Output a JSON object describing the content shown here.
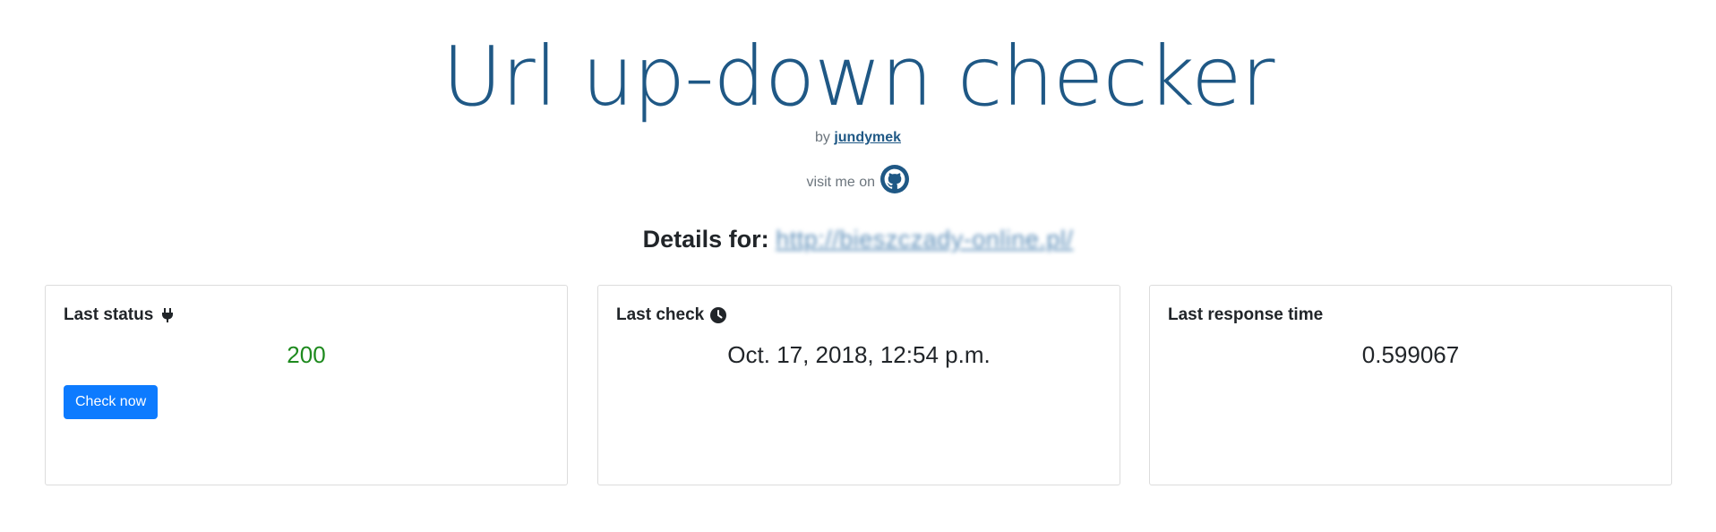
{
  "header": {
    "title": "Url up-down checker",
    "by_prefix": "by",
    "author": "jundymek",
    "visit_text": "visit me on",
    "github_icon": "github-icon"
  },
  "details": {
    "label": "Details for:",
    "url": "http://bieszczady-online.pl/"
  },
  "cards": {
    "status": {
      "title": "Last status",
      "icon": "plug-icon",
      "value": "200",
      "button_label": "Check now",
      "value_color": "#1e8a1e"
    },
    "check": {
      "title": "Last check",
      "icon": "clock-icon",
      "value": "Oct. 17, 2018, 12:54 p.m."
    },
    "response": {
      "title": "Last response time",
      "value": "0.599067"
    }
  },
  "colors": {
    "title": "#1f5885",
    "button": "#0d7bff"
  }
}
